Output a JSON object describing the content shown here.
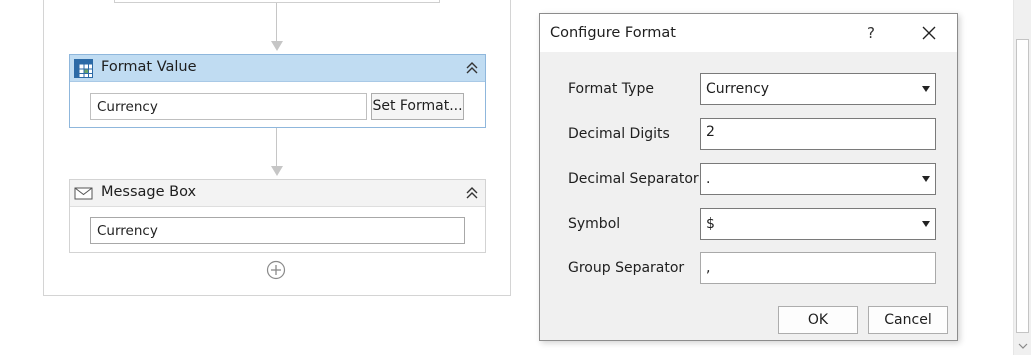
{
  "workflow": {
    "format_value": {
      "title": "Format Value",
      "input_value": "Currency",
      "set_format_label": "Set Format..."
    },
    "message_box": {
      "title": "Message Box",
      "input_value": "Currency"
    }
  },
  "dialog": {
    "title": "Configure Format",
    "help_label": "?",
    "fields": {
      "format_type": {
        "label": "Format Type",
        "value": "Currency"
      },
      "decimal_digits": {
        "label": "Decimal Digits",
        "value": "2"
      },
      "decimal_separator": {
        "label": "Decimal Separator",
        "value": "."
      },
      "symbol": {
        "label": "Symbol",
        "value": "$"
      },
      "group_separator": {
        "label": "Group Separator",
        "value": ","
      }
    },
    "ok_label": "OK",
    "cancel_label": "Cancel"
  },
  "colors": {
    "selected_header": "#c0dcf2",
    "selected_border": "#8fb7dc",
    "dialog_background": "#f0f0f0"
  }
}
